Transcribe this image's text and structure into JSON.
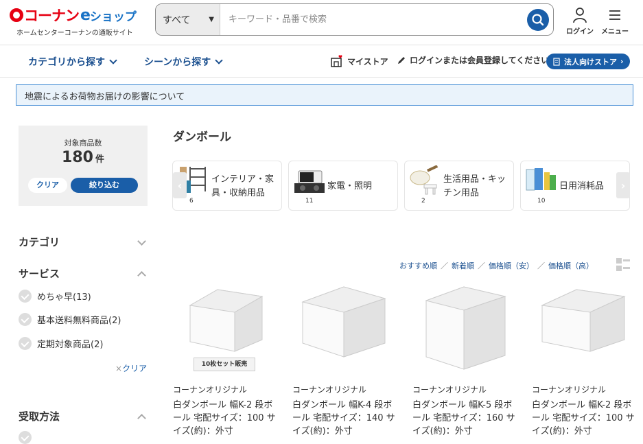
{
  "header": {
    "logo_main": "コーナン",
    "logo_e": "e",
    "logo_shop": "ショップ",
    "logo_sub": "ホームセンターコーナンの通販サイト",
    "search_category": "すべて",
    "search_placeholder": "キーワード・品番で検索",
    "login_label": "ログイン",
    "menu_label": "メニュー"
  },
  "nav": {
    "category": "カテゴリから探す",
    "scene": "シーンから探す",
    "my_store": "マイストア",
    "login_prompt": "ログインまたは会員登録してください",
    "business_store": "法人向けストア"
  },
  "notice": "地震によるお荷物お届けの影響について",
  "sidebar": {
    "count_label": "対象商品数",
    "count_value": "180",
    "count_unit": "件",
    "clear": "クリア",
    "narrow": "絞り込む",
    "category_heading": "カテゴリ",
    "service_heading": "サービス",
    "services": [
      {
        "label": "めちゃ早(13)"
      },
      {
        "label": "基本送料無料商品(2)"
      },
      {
        "label": "定期対象商品(2)"
      }
    ],
    "service_clear": "クリア",
    "receive_heading": "受取方法"
  },
  "main": {
    "title": "ダンボール",
    "categories": [
      {
        "label": "インテリア・家具・収納用品",
        "count": "6"
      },
      {
        "label": "家電・照明",
        "count": "11"
      },
      {
        "label": "生活用品・キッチン用品",
        "count": "2"
      },
      {
        "label": "日用消耗品",
        "count": "10"
      }
    ],
    "sort": [
      "おすすめ順",
      "新着順",
      "価格順（安）",
      "価格順（高）"
    ],
    "products": [
      {
        "brand": "コーナンオリジナル",
        "name": "白ダンボール 幅K-2 段ボール 宅配サイズ：100 サイズ(約)：外寸",
        "tag": "10枚セット販売"
      },
      {
        "brand": "コーナンオリジナル",
        "name": "白ダンボール 幅K-4 段ボール 宅配サイズ：140 サイズ(約)：外寸",
        "tag": ""
      },
      {
        "brand": "コーナンオリジナル",
        "name": "白ダンボール 幅K-5 段ボール 宅配サイズ：160 サイズ(約)：外寸",
        "tag": ""
      },
      {
        "brand": "コーナンオリジナル",
        "name": "白ダンボール 幅K-2 段ボール 宅配サイズ：100 サイズ(約)：外寸",
        "tag": ""
      }
    ]
  },
  "colors": {
    "brand_red": "#e60012",
    "brand_blue": "#1a5ea8",
    "link_navy": "#1a4f8f"
  }
}
